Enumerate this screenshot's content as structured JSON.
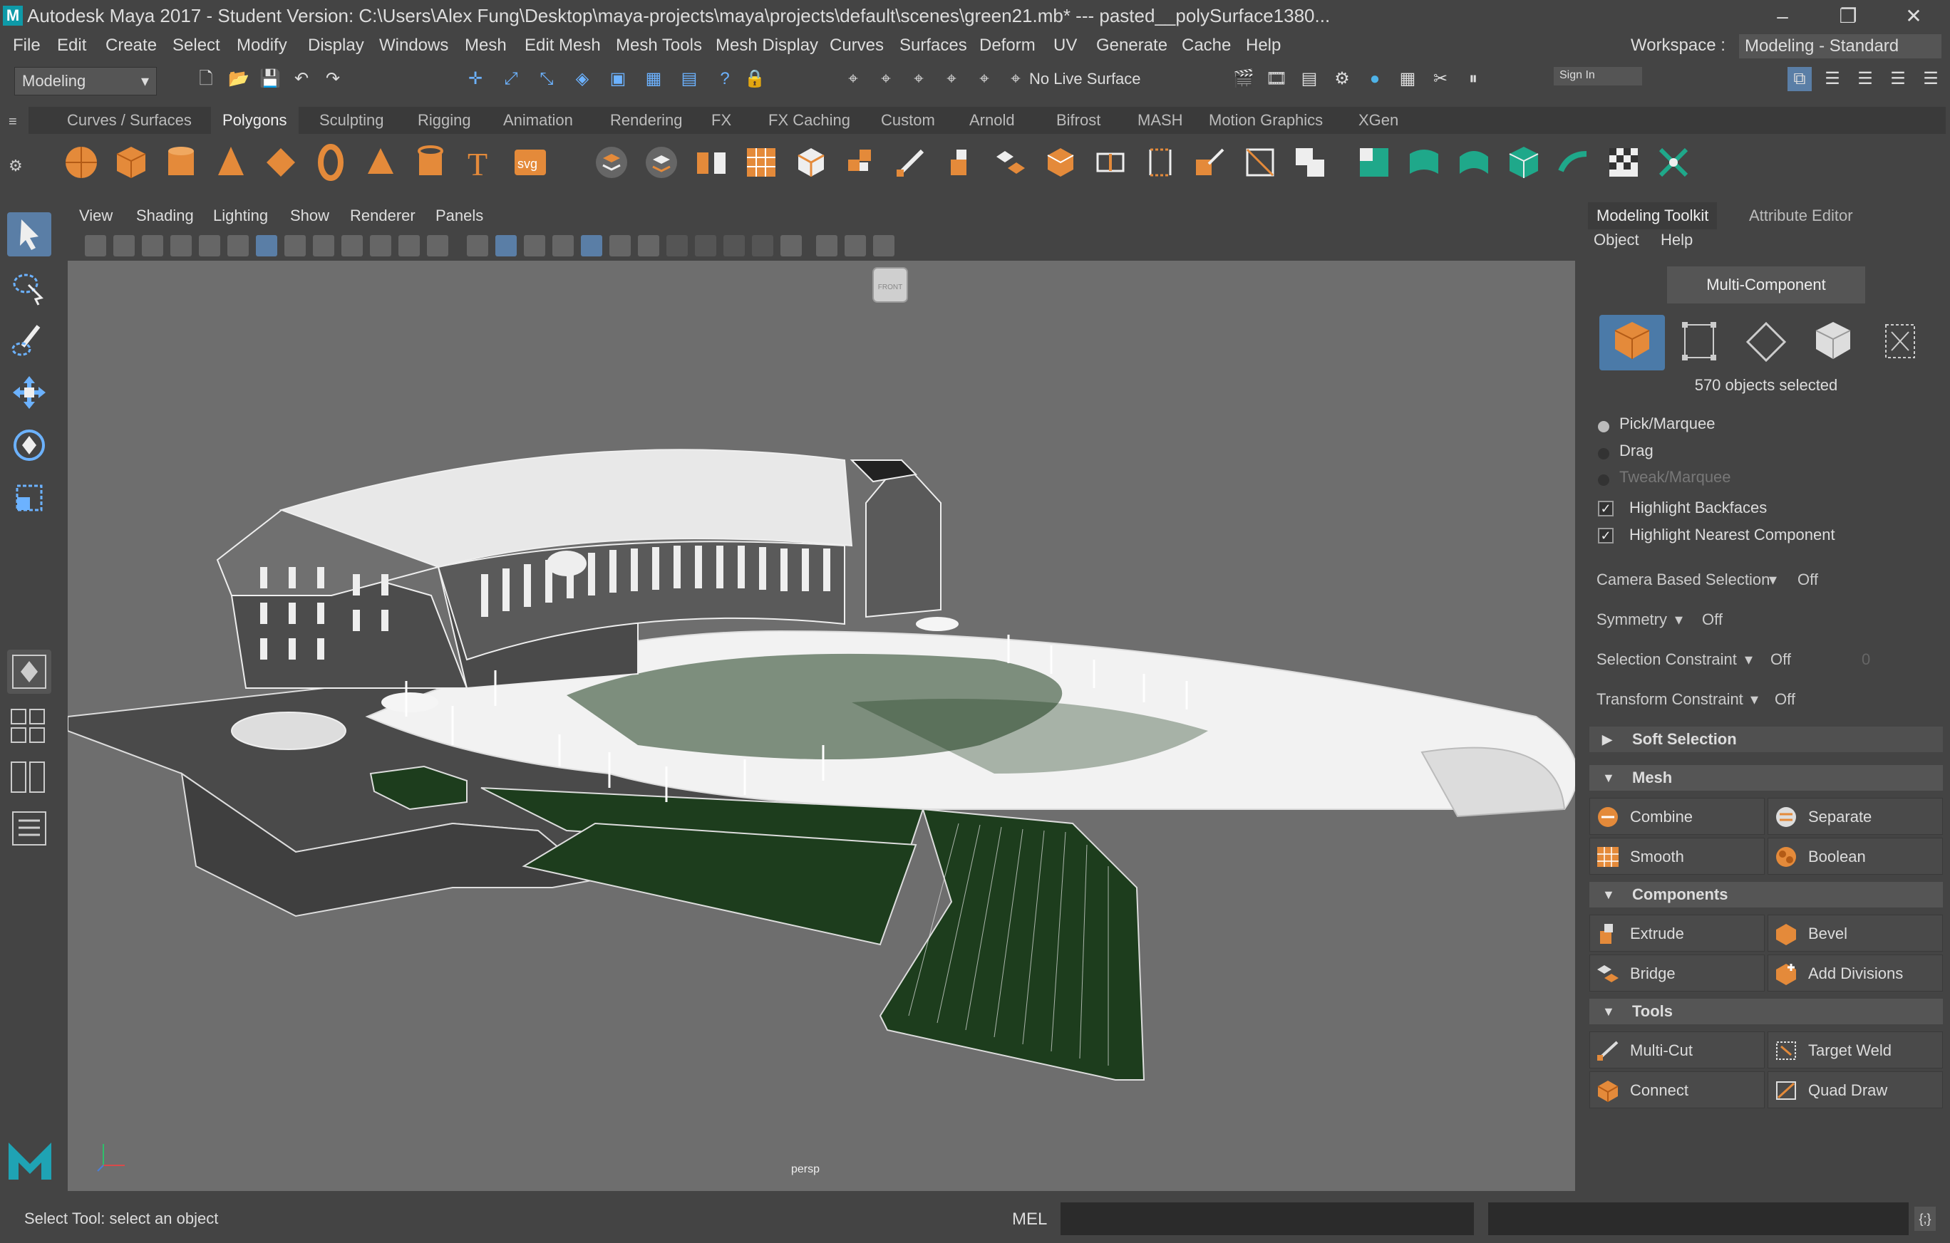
{
  "title": "Autodesk Maya 2017 - Student Version: C:\\Users\\Alex Fung\\Desktop\\maya-projects\\maya\\projects\\default\\scenes\\green21.mb*   ---   pasted__polySurface1380...",
  "menus": [
    "File",
    "Edit",
    "Create",
    "Select",
    "Modify",
    "Display",
    "Windows",
    "Mesh",
    "Edit Mesh",
    "Mesh Tools",
    "Mesh Display",
    "Curves",
    "Surfaces",
    "Deform",
    "UV",
    "Generate",
    "Cache",
    "Help"
  ],
  "workspace": {
    "label": "Workspace :",
    "value": "Modeling - Standard"
  },
  "mode_dropdown": "Modeling",
  "live_surface": "No Live Surface",
  "sign_in": "Sign In",
  "shelf_tabs": [
    "Curves / Surfaces",
    "Polygons",
    "Sculpting",
    "Rigging",
    "Animation",
    "Rendering",
    "FX",
    "FX Caching",
    "Custom",
    "Arnold",
    "Bifrost",
    "MASH",
    "Motion Graphics",
    "XGen"
  ],
  "shelf_active": "Polygons",
  "viewport_menu": [
    "View",
    "Shading",
    "Lighting",
    "Show",
    "Renderer",
    "Panels"
  ],
  "viewcube_label": "FRONT",
  "camera_label": "persp",
  "panel": {
    "tabs": [
      "Modeling Toolkit",
      "Attribute Editor"
    ],
    "menu": [
      "Object",
      "Help"
    ],
    "multi_component": "Multi-Component",
    "objects_selected": "570 objects selected",
    "radios": [
      "Pick/Marquee",
      "Drag",
      "Tweak/Marquee"
    ],
    "checks": [
      "Highlight Backfaces",
      "Highlight Nearest Component"
    ],
    "props": [
      {
        "label": "Camera Based Selection",
        "value": "Off"
      },
      {
        "label": "Symmetry",
        "value": "Off"
      },
      {
        "label": "Selection Constraint",
        "value": "Off",
        "extra": "0"
      },
      {
        "label": "Transform Constraint",
        "value": "Off"
      }
    ],
    "soft_selection": "Soft Selection",
    "mesh_section": "Mesh",
    "mesh_buttons": [
      "Combine",
      "Separate",
      "Smooth",
      "Boolean"
    ],
    "components_section": "Components",
    "component_buttons": [
      "Extrude",
      "Bevel",
      "Bridge",
      "Add Divisions"
    ],
    "tools_section": "Tools",
    "tool_buttons": [
      "Multi-Cut",
      "Target Weld",
      "Connect",
      "Quad Draw"
    ]
  },
  "help_line": "Select Tool: select an object",
  "mel_label": "MEL",
  "colors": {
    "accent": "#4b7aa8",
    "orange": "#e48a3a",
    "green": "#1fa88a",
    "viewport": "#6e6e6e",
    "lawn": "#1d3d1d"
  }
}
